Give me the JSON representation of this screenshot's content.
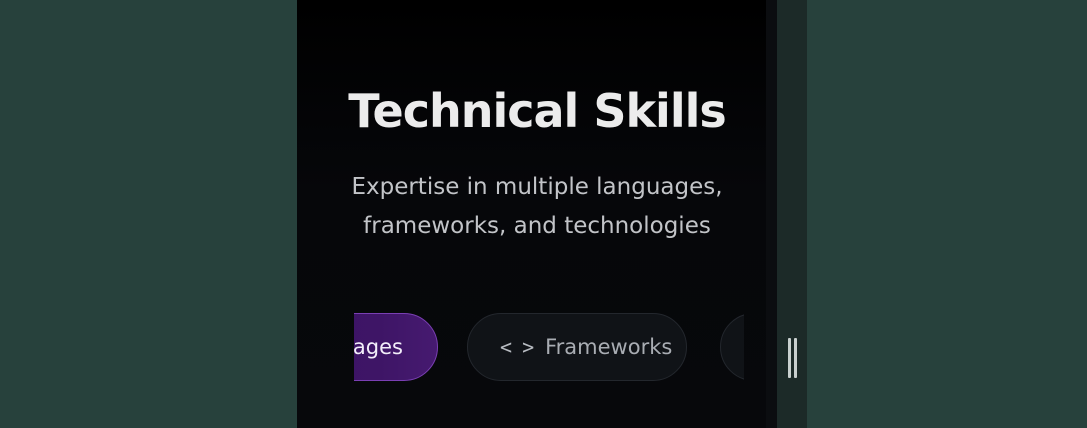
{
  "section": {
    "title": "Technical Skills",
    "subtitle_line1": "Expertise in multiple languages,",
    "subtitle_line2": "frameworks, and technologies"
  },
  "tabs": [
    {
      "label": "Languages",
      "visible_label": "uages",
      "active": true
    },
    {
      "label": "Frameworks",
      "icon": "code-icon",
      "active": false
    },
    {
      "label": "",
      "active": false
    }
  ],
  "colors": {
    "background": "#27413c",
    "panel": "#06070a",
    "active_chip": "#3e1566",
    "active_border": "#7a3fb3",
    "chip": "#101317"
  }
}
